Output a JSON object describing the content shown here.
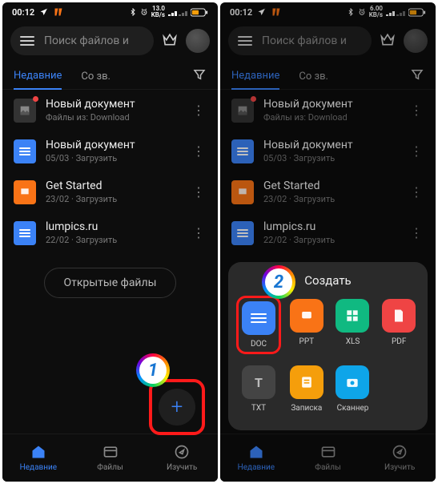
{
  "status": {
    "time": "00:12",
    "rate1": "13.0",
    "rate2": "6.00",
    "rate_unit": "KB/s"
  },
  "search": {
    "placeholder": "Поиск файлов и"
  },
  "tabs": {
    "recent": "Недавние",
    "starred": "Со зв."
  },
  "files": [
    {
      "name": "Новый документ",
      "sub": "Файлы из: Download",
      "icon": "img",
      "dot": true
    },
    {
      "name": "Новый документ",
      "sub": "05/03 · Загрузить",
      "icon": "blue",
      "dot": false
    },
    {
      "name": "Get Started",
      "sub": "23/02 · Загрузить",
      "icon": "orange",
      "dot": false
    },
    {
      "name": "lumpics.ru",
      "sub": "22/02 · Загрузить",
      "icon": "blue",
      "dot": false
    }
  ],
  "open_files_btn": "Открытые файлы",
  "bottom": {
    "recent": "Недавние",
    "files": "Файлы",
    "explore": "Изучить"
  },
  "sheet": {
    "title": "Создать",
    "options": [
      {
        "key": "doc",
        "label": "DOC"
      },
      {
        "key": "ppt",
        "label": "PPT"
      },
      {
        "key": "xls",
        "label": "XLS"
      },
      {
        "key": "pdf",
        "label": "PDF"
      },
      {
        "key": "txt",
        "label": "TXT"
      },
      {
        "key": "note",
        "label": "Записка"
      },
      {
        "key": "scan",
        "label": "Сканнер"
      }
    ]
  },
  "steps": {
    "s1": "1",
    "s2": "2"
  }
}
